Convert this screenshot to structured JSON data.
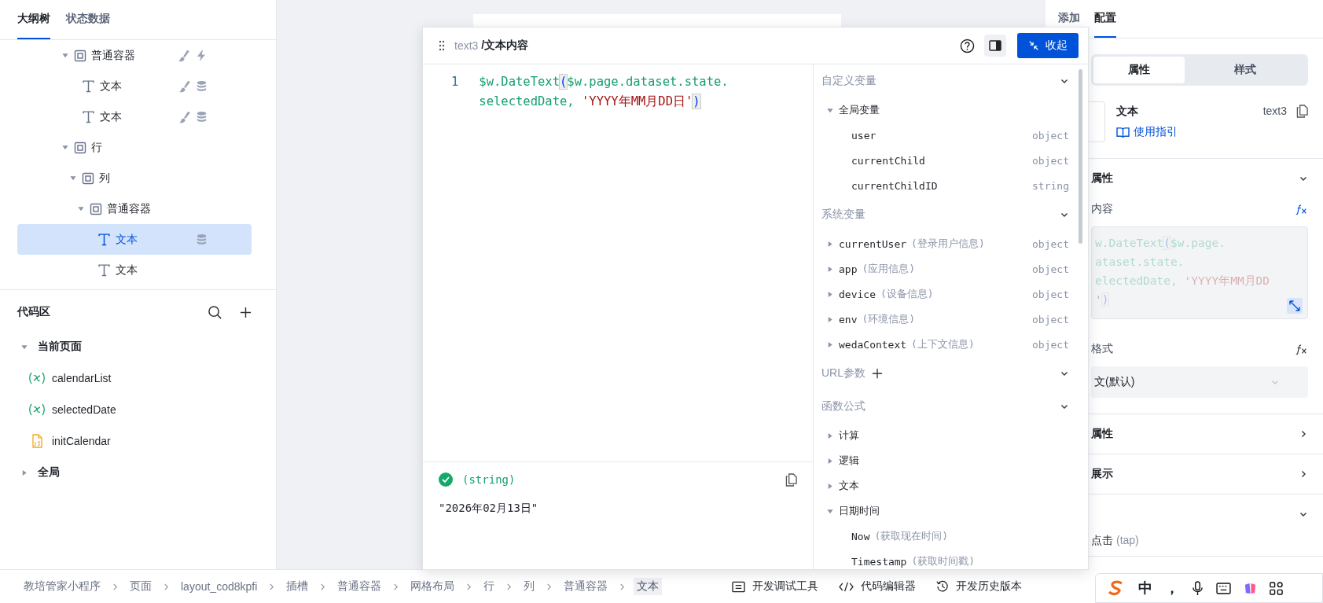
{
  "left_panel": {
    "tabs": [
      {
        "label": "大纲树",
        "selected": true
      },
      {
        "label": "状态数据",
        "selected": false
      }
    ],
    "tree": [
      {
        "label": "普通容器",
        "kind": "container",
        "expanded": true,
        "selected": false,
        "badges": [
          {
            "kind": "brush"
          },
          {
            "kind": "bolt"
          }
        ],
        "children": [
          {
            "label": "文本",
            "kind": "text",
            "selected": false,
            "badges": [
              {
                "kind": "brush"
              },
              {
                "kind": "database"
              }
            ]
          },
          {
            "label": "文本",
            "kind": "text",
            "selected": false,
            "badges": [
              {
                "kind": "brush"
              },
              {
                "kind": "database"
              }
            ]
          }
        ]
      },
      {
        "label": "行",
        "kind": "container",
        "expanded": true,
        "selected": false,
        "children": [
          {
            "label": "列",
            "kind": "container",
            "expanded": true,
            "selected": false,
            "children": [
              {
                "label": "普通容器",
                "kind": "container",
                "expanded": true,
                "selected": false,
                "children": [
                  {
                    "label": "文本",
                    "kind": "text",
                    "selected": true,
                    "badges": [
                      {
                        "kind": "database"
                      }
                    ]
                  },
                  {
                    "label": "文本",
                    "kind": "text",
                    "selected": false
                  }
                ]
              }
            ]
          }
        ]
      }
    ],
    "code_area": {
      "title": "代码区",
      "groups": [
        {
          "label": "当前页面",
          "expanded": true,
          "items": [
            {
              "label": "calendarList",
              "kind": "variable"
            },
            {
              "label": "selectedDate",
              "kind": "variable"
            },
            {
              "label": "initCalendar",
              "kind": "script"
            }
          ]
        },
        {
          "label": "全局",
          "expanded": false
        }
      ]
    }
  },
  "editor_dialog": {
    "path": "text3",
    "title": "/文本内容",
    "collapse_button": "收起",
    "code_lines": [
      {
        "number": "1",
        "tokens": [
          {
            "kind": "ident",
            "text": "$w.DateText"
          },
          {
            "kind": "bracket",
            "text": "("
          },
          {
            "kind": "ident",
            "text": "$w.page.dataset.state.selectedDate, "
          },
          {
            "kind": "string",
            "text": "'YYYY年MM月DD日'"
          },
          {
            "kind": "bracket",
            "text": ")"
          }
        ]
      }
    ],
    "result": {
      "ok": true,
      "type": "(string)",
      "value": "\"2026年02月13日\""
    },
    "sections": [
      {
        "title": "自定义变量",
        "expanded": true,
        "items": [
          {
            "name": "全局变量",
            "expanded": true,
            "children": [
              {
                "name": "user",
                "type": "object"
              },
              {
                "name": "currentChild",
                "type": "object"
              },
              {
                "name": "currentChildID",
                "type": "string"
              }
            ]
          }
        ]
      },
      {
        "title": "系统变量",
        "expanded": true,
        "items": [
          {
            "name": "currentUser",
            "desc": "(登录用户信息)",
            "type": "object",
            "expanded": false
          },
          {
            "name": "app",
            "desc": "(应用信息)",
            "type": "object",
            "expanded": false
          },
          {
            "name": "device",
            "desc": "(设备信息)",
            "type": "object",
            "expanded": false
          },
          {
            "name": "env",
            "desc": "(环境信息)",
            "type": "object",
            "expanded": false
          },
          {
            "name": "wedaContext",
            "desc": "(上下文信息)",
            "type": "object",
            "expanded": false
          }
        ]
      },
      {
        "title": "URL参数",
        "addable": true,
        "expanded": true
      },
      {
        "title": "函数公式",
        "expanded": true,
        "items": [
          {
            "name": "计算",
            "expanded": false
          },
          {
            "name": "逻辑",
            "expanded": false
          },
          {
            "name": "文本",
            "expanded": false
          },
          {
            "name": "日期时间",
            "expanded": true,
            "children": [
              {
                "name": "Now",
                "desc": "(获取现在时间)"
              },
              {
                "name": "Timestamp",
                "desc": "(获取时间戳)"
              }
            ]
          }
        ]
      }
    ]
  },
  "config_panel": {
    "tabs": [
      {
        "label": "添加",
        "selected": false
      },
      {
        "label": "配置",
        "selected": true
      }
    ],
    "segments": [
      {
        "label": "属性",
        "selected": true
      },
      {
        "label": "样式",
        "selected": false
      }
    ],
    "component": {
      "name": "文本",
      "guide_link": "使用指引",
      "id": "text3"
    },
    "sections": [
      {
        "title": "属性",
        "expanded": true,
        "fields": [
          {
            "kind": "code",
            "label": "内容",
            "bound": true,
            "lines": [
              [
                {
                  "kind": "ident",
                  "text": "w.DateText"
                },
                {
                  "kind": "bracket",
                  "text": "("
                },
                {
                  "kind": "ident",
                  "text": "$w.page."
                }
              ],
              [
                {
                  "kind": "ident",
                  "text": "ataset.state."
                }
              ],
              [
                {
                  "kind": "ident",
                  "text": "electedDate, "
                },
                {
                  "kind": "string",
                  "text": "'YYYY年MM月DD"
                }
              ],
              [
                {
                  "kind": "string",
                  "text": "'"
                },
                {
                  "kind": "bracket",
                  "text": ")"
                }
              ]
            ]
          },
          {
            "kind": "select",
            "label": "格式",
            "bound": false,
            "value": "文(默认)"
          }
        ]
      },
      {
        "title": "属性",
        "expanded": false
      },
      {
        "title": "展示",
        "expanded": false
      },
      {
        "expanded": true,
        "events": [
          {
            "label": "点击",
            "name": "(tap)"
          }
        ]
      }
    ]
  },
  "breadcrumbs": [
    {
      "label": "教培管家小程序",
      "selected": false
    },
    {
      "label": "页面",
      "selected": false
    },
    {
      "label": "layout_cod8kpfi",
      "selected": false
    },
    {
      "label": "插槽",
      "selected": false
    },
    {
      "label": "普通容器",
      "selected": false
    },
    {
      "label": "网格布局",
      "selected": false
    },
    {
      "label": "行",
      "selected": false
    },
    {
      "label": "列",
      "selected": false
    },
    {
      "label": "普通容器",
      "selected": false
    },
    {
      "label": "文本",
      "selected": true
    }
  ],
  "tools": [
    {
      "kind": "debug",
      "label": "开发调试工具"
    },
    {
      "kind": "code",
      "label": "代码编辑器"
    },
    {
      "kind": "history",
      "label": "开发历史版本"
    }
  ],
  "ime_toolbar": {
    "mode": "中",
    "punctuation": "，"
  }
}
